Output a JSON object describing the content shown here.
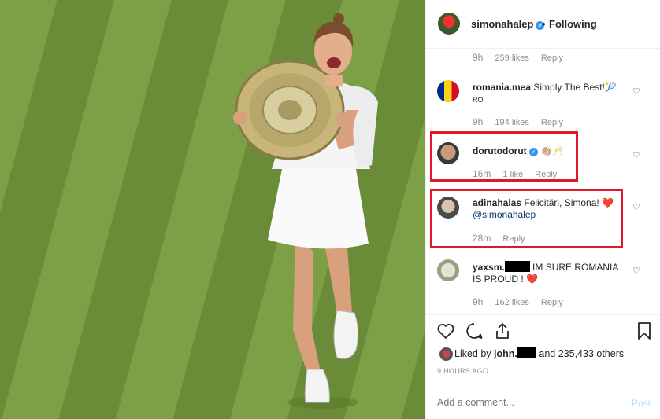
{
  "post": {
    "owner": "simonahalep",
    "separator": "•",
    "follow_status": "Following",
    "verified_glyph": "✓"
  },
  "comments": [
    {
      "id": "c0",
      "time": "9h",
      "likes": "259 likes",
      "reply": "Reply"
    },
    {
      "id": "c1",
      "user": "romania.mea",
      "text": "Simply The Best!🎾",
      "subtext": "RO",
      "time": "9h",
      "likes": "194 likes",
      "reply": "Reply"
    },
    {
      "id": "c2",
      "user": "dorutodorut",
      "text": "👏🏼🥂",
      "time": "16m",
      "likes": "1 like",
      "reply": "Reply",
      "verified": true
    },
    {
      "id": "c3",
      "user": "adinahalas",
      "text": "Felicitări, Simona! ❤️",
      "mention": "@simonahalep",
      "time": "28m",
      "reply": "Reply"
    },
    {
      "id": "c4",
      "user": "yaxsm.",
      "text": "IM SURE ROMANIA IS PROUD ! ❤️",
      "time": "9h",
      "likes": "162 likes",
      "reply": "Reply"
    }
  ],
  "likes_line": {
    "prefix": "Liked by",
    "user": "john.",
    "suffix": "and 235,433 others"
  },
  "time_ago": "9 HOURS AGO",
  "comment_box": {
    "placeholder": "Add a comment...",
    "post_label": "Post"
  },
  "colors": {
    "highlight_box": "#e0192a",
    "verified": "#3897f0",
    "heart": "#e0192a",
    "post_disabled": "#b2dffc"
  },
  "icons": {
    "like": "heart-outline-icon",
    "comment": "comment-bubble-icon",
    "share": "share-icon",
    "save": "bookmark-icon",
    "comment_like": "small-heart-icon"
  }
}
